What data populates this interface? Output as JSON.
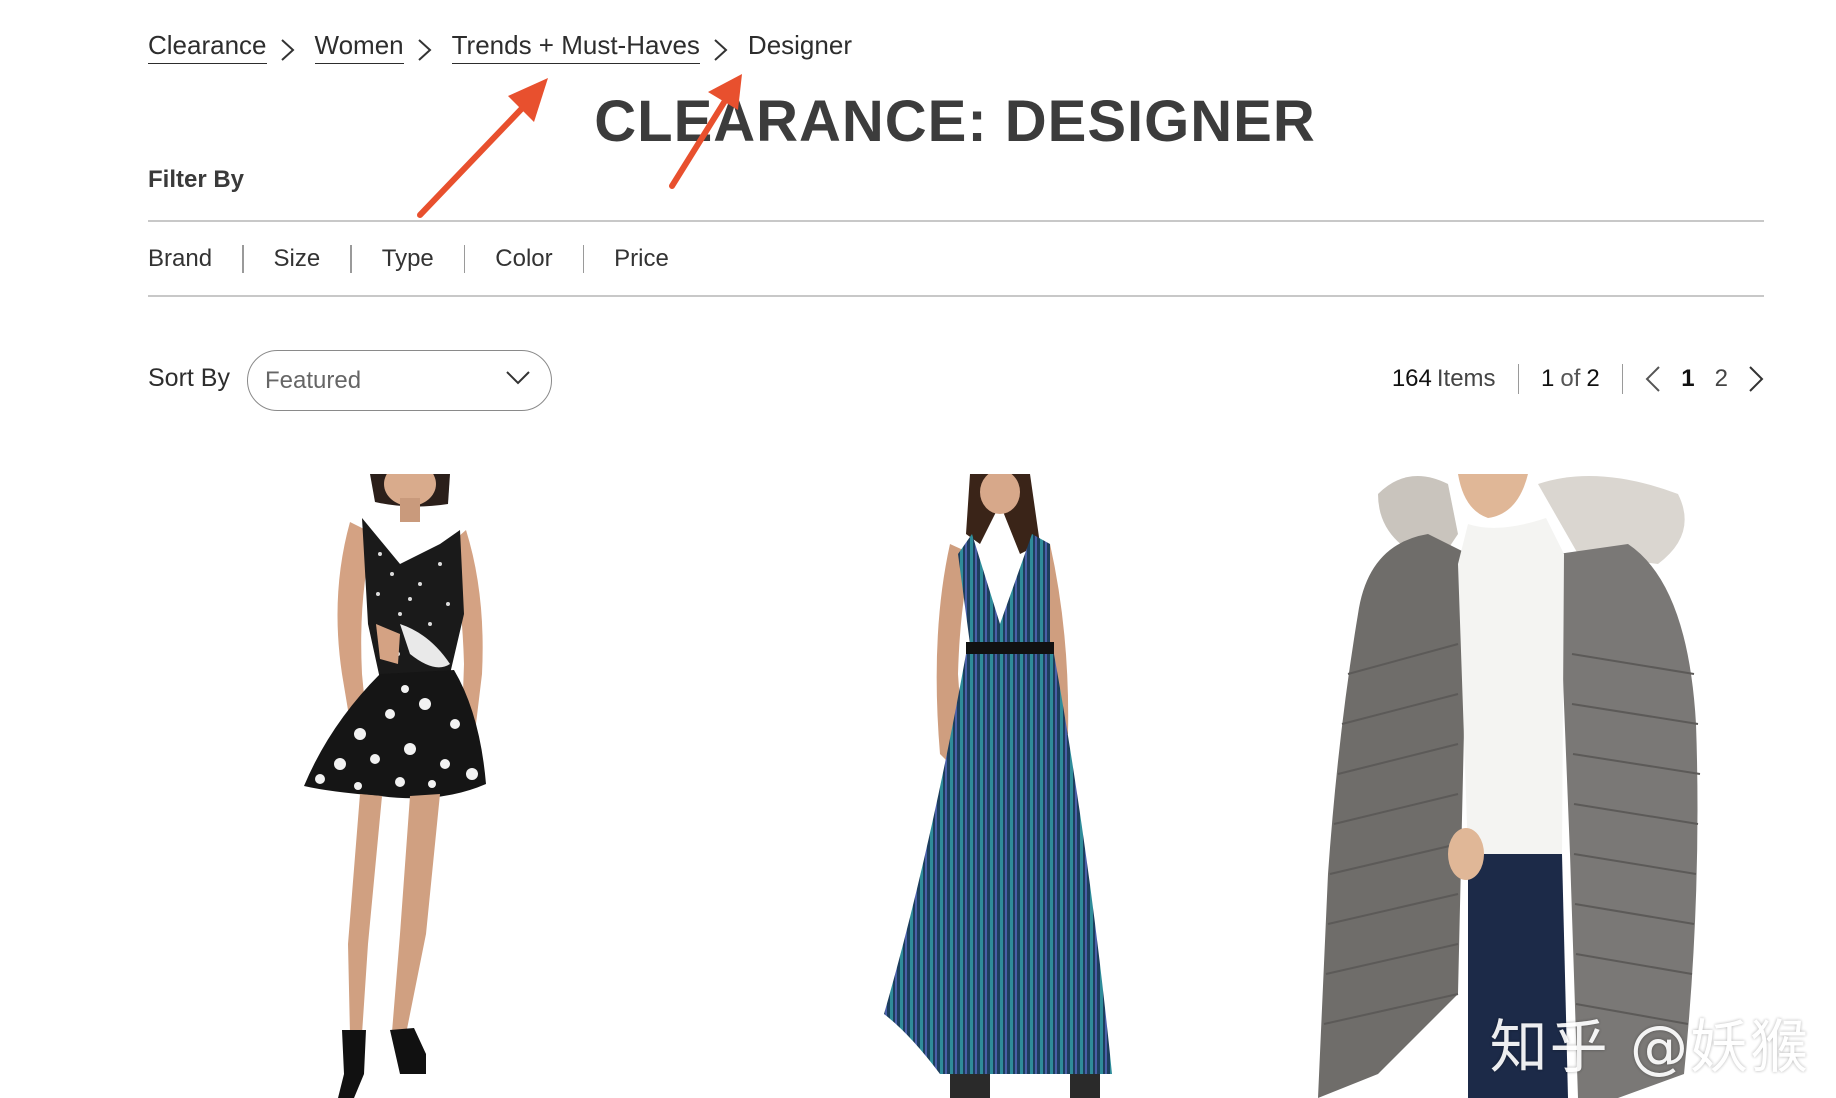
{
  "breadcrumb": {
    "items": [
      {
        "label": "Clearance"
      },
      {
        "label": "Women"
      },
      {
        "label": "Trends + Must-Haves"
      }
    ],
    "current": "Designer"
  },
  "page_title": "CLEARANCE: DESIGNER",
  "filter": {
    "label": "Filter By",
    "options": [
      "Brand",
      "Size",
      "Type",
      "Color",
      "Price"
    ]
  },
  "sort": {
    "label": "Sort By",
    "selected": "Featured"
  },
  "results": {
    "count": "164",
    "count_word": "Items",
    "page_current": "1",
    "page_of_word": "of",
    "page_total": "2"
  },
  "pagination": {
    "pages": [
      "1",
      "2"
    ],
    "active_page": "1"
  },
  "products": [
    {
      "image": "polka-dot-mini-dress"
    },
    {
      "image": "striped-maxi-dress"
    },
    {
      "image": "grey-puffer-coat-fur-hood"
    }
  ],
  "annotations": {
    "arrow_color": "#e8502e"
  },
  "watermark": "知乎 @妖猴"
}
